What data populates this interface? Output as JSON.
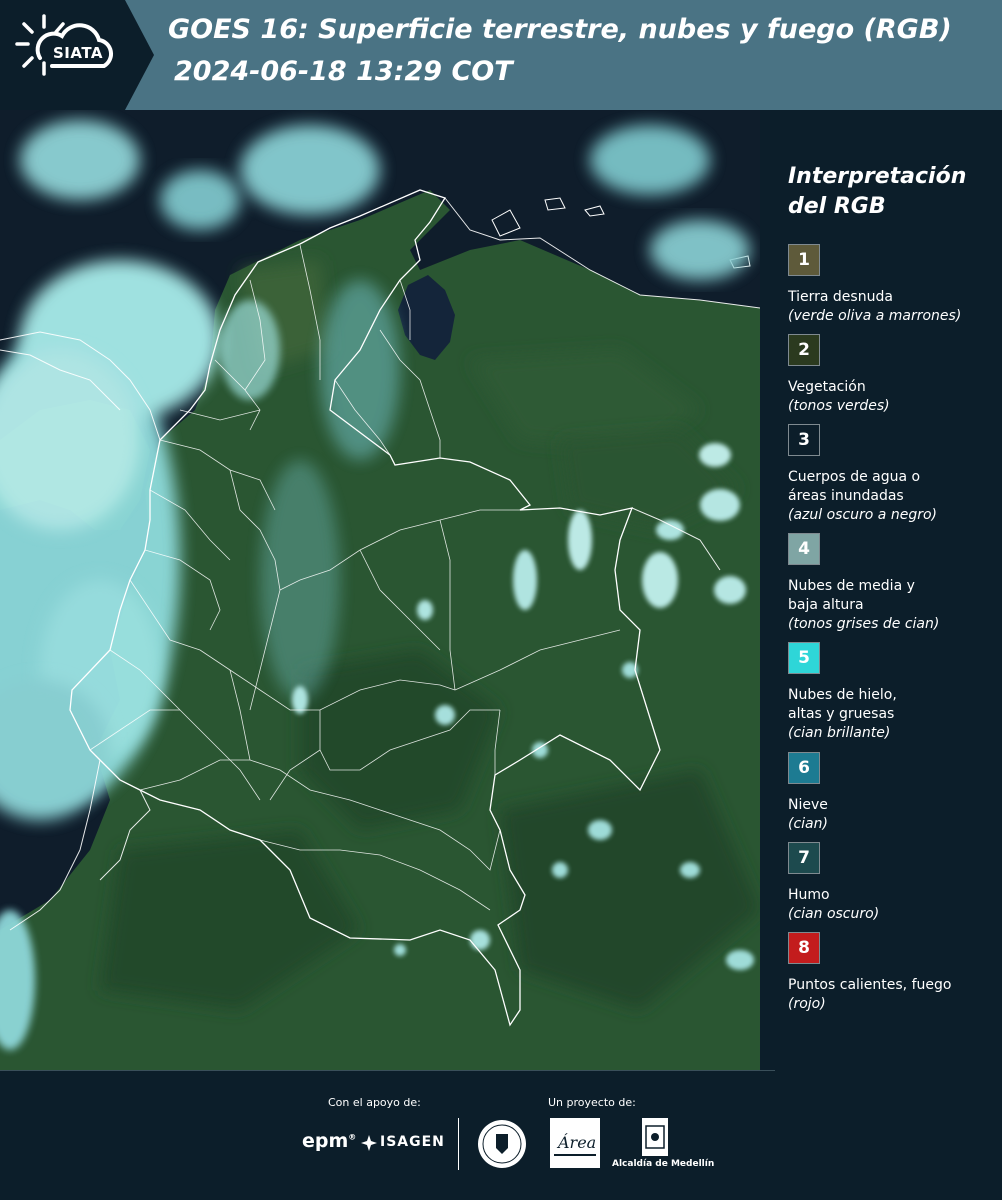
{
  "header": {
    "logo_text": "SIATA",
    "title_line1": "GOES 16: Superficie terrestre, nubes y fuego (RGB)",
    "title_line2": "2024-06-18 13:29 COT"
  },
  "map": {
    "description_colors": {
      "vegetation": "#2a5a34",
      "water": "#0e1c2a",
      "clouds": "#9fe8ea",
      "border": "#ffffff"
    }
  },
  "legend": {
    "title": "Interpretación del RGB",
    "items": [
      {
        "number": "1",
        "label": "Tierra desnuda",
        "note": "(verde oliva a marrones)",
        "color": "#5e5a3a"
      },
      {
        "number": "2",
        "label": "Vegetación",
        "note": "(tonos verdes)",
        "color": "#2b3a1f"
      },
      {
        "number": "3",
        "label": "Cuerpos de agua o\náreas inundadas",
        "note": "(azul oscuro a negro)",
        "color": "#0c1e2a"
      },
      {
        "number": "4",
        "label": "Nubes de media y\nbaja altura",
        "note": "(tonos grises de cian)",
        "color": "#7fa5a4"
      },
      {
        "number": "5",
        "label": "Nubes de hielo,\naltas y gruesas",
        "note": "(cian brillante)",
        "color": "#2ed6d8"
      },
      {
        "number": "6",
        "label": "Nieve",
        "note": "(cian)",
        "color": "#1d7b92"
      },
      {
        "number": "7",
        "label": "Humo",
        "note": "(cian oscuro)",
        "color": "#1d4a4e"
      },
      {
        "number": "8",
        "label": "Puntos calientes, fuego",
        "note": "(rojo)",
        "color": "#c31c1d"
      }
    ]
  },
  "footer": {
    "support_caption": "Con el apoyo de:",
    "project_caption": "Un proyecto de:",
    "epm": "epm",
    "isagen": "ISAGEN",
    "area_metropolitana": "Área",
    "alcaldia": "Alcaldía de Medellín"
  }
}
